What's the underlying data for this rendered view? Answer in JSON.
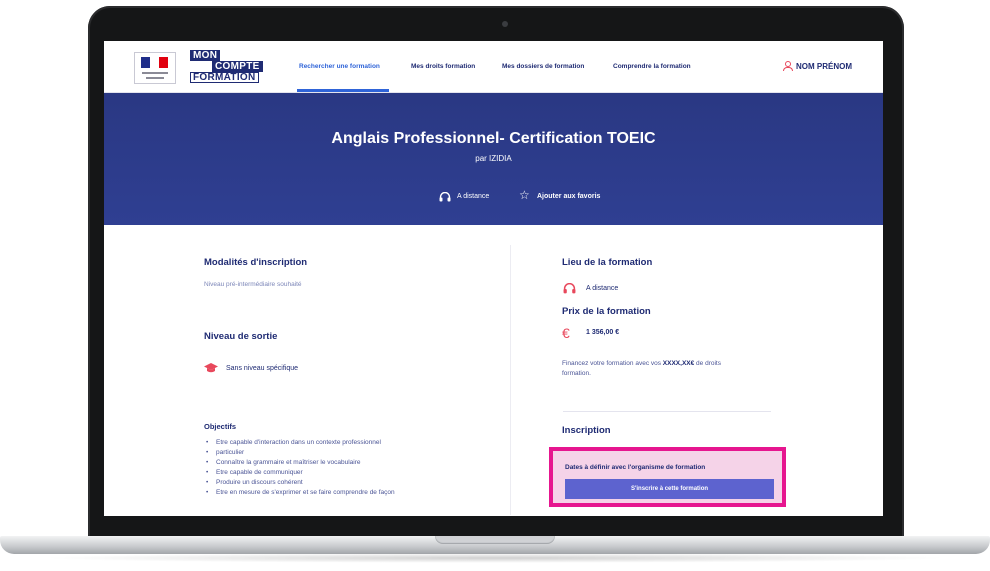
{
  "header": {
    "logo": {
      "line1": "MON",
      "line2": "COMPTE",
      "line3": "FORMATION"
    },
    "nav": [
      {
        "label": "Rechercher une formation",
        "active": true
      },
      {
        "label": "Mes droits formation",
        "active": false
      },
      {
        "label": "Mes dossiers de formation",
        "active": false
      },
      {
        "label": "Comprendre la formation",
        "active": false
      }
    ],
    "user": "NOM PRÉNOM"
  },
  "hero": {
    "title": "Anglais Professionnel- Certification TOEIC",
    "provider": "par IZIDIA",
    "mode": "A distance",
    "favorite_label": "Ajouter aux favoris"
  },
  "left": {
    "inscription_title": "Modalités d'inscription",
    "inscription_text": "Niveau pré-intermédiaire souhaité",
    "exit_level_title": "Niveau de sortie",
    "exit_level_text": "Sans niveau spécifique",
    "objectives_title": "Objectifs",
    "objectives": [
      "Etre capable d'interaction dans un contexte professionnel",
      "particulier",
      "Connaître la grammaire et maîtriser le vocabulaire",
      "Etre capable de communiquer",
      "Produire un discours cohérent",
      "Etre en mesure de s'exprimer et se faire comprendre de façon"
    ]
  },
  "right": {
    "location_title": "Lieu de la formation",
    "location_text": "A distance",
    "price_title": "Prix de la formation",
    "price": "1 356,00 €",
    "finance_text_pre": "Financez votre formation avec vos ",
    "finance_amount": "XXXX,XX€",
    "finance_text_post": " de droits",
    "finance_text_line2": "formation.",
    "inscription_title": "Inscription",
    "dates_text": "Dates à définir avec l'organisme de formation",
    "cta_label": "S'inscrire à cette formation"
  },
  "colors": {
    "primary": "#1f2b73",
    "hero": "#2f3f92",
    "accent_link": "#2f64d8",
    "icon_red": "#e8485c",
    "highlight_border": "#e6168f",
    "highlight_bg": "#f5d3e8",
    "cta": "#5d63cf"
  }
}
